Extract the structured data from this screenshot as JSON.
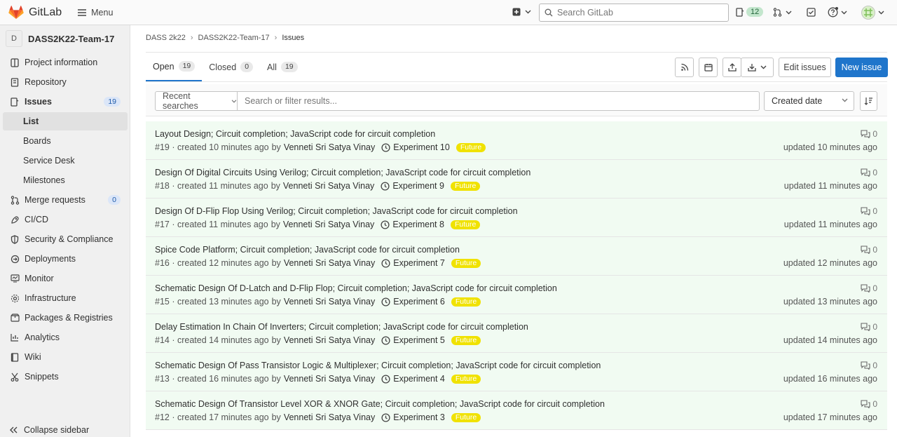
{
  "topbar": {
    "brand": "GitLab",
    "menu_label": "Menu",
    "search_placeholder": "Search GitLab",
    "issues_count": "12",
    "colors": {
      "brand_orange": "#fc6d26",
      "accent_blue": "#1f75cb",
      "label_yellow": "#f0e200"
    }
  },
  "sidebar": {
    "project_initial": "D",
    "project_name": "DASS2K22-Team-17",
    "items": [
      {
        "label": "Project information",
        "icon": "info-icon"
      },
      {
        "label": "Repository",
        "icon": "book-icon"
      },
      {
        "label": "Issues",
        "icon": "issues-icon",
        "badge": "19"
      },
      {
        "label": "List"
      },
      {
        "label": "Boards"
      },
      {
        "label": "Service Desk"
      },
      {
        "label": "Milestones"
      },
      {
        "label": "Merge requests",
        "icon": "git-merge-icon",
        "badge": "0"
      },
      {
        "label": "CI/CD",
        "icon": "rocket-icon"
      },
      {
        "label": "Security & Compliance",
        "icon": "shield-icon"
      },
      {
        "label": "Deployments",
        "icon": "deployments-icon"
      },
      {
        "label": "Monitor",
        "icon": "monitor-icon"
      },
      {
        "label": "Infrastructure",
        "icon": "cloud-gear-icon"
      },
      {
        "label": "Packages & Registries",
        "icon": "package-icon"
      },
      {
        "label": "Analytics",
        "icon": "chart-icon"
      },
      {
        "label": "Wiki",
        "icon": "wiki-icon"
      },
      {
        "label": "Snippets",
        "icon": "scissors-icon"
      }
    ],
    "collapse_label": "Collapse sidebar"
  },
  "breadcrumb": [
    "DASS 2k22",
    "DASS2K22-Team-17",
    "Issues"
  ],
  "tabs": [
    {
      "label": "Open",
      "count": "19"
    },
    {
      "label": "Closed",
      "count": "0"
    },
    {
      "label": "All",
      "count": "19"
    }
  ],
  "actions": {
    "edit_issues": "Edit issues",
    "new_issue": "New issue"
  },
  "filter": {
    "recent_searches": "Recent searches",
    "placeholder": "Search or filter results...",
    "sort": "Created date"
  },
  "issues": [
    {
      "title": "Layout Design; Circuit completion; JavaScript code for circuit completion",
      "ref": "#19 · created 10 minutes ago",
      "author": "Venneti Sri Satya Vinay",
      "milestone": "Experiment 10",
      "label": "Future",
      "comments": "0",
      "updated": "updated 10 minutes ago"
    },
    {
      "title": "Design Of Digital Circuits Using Verilog; Circuit completion; JavaScript code for circuit completion",
      "ref": "#18 · created 11 minutes ago",
      "author": "Venneti Sri Satya Vinay",
      "milestone": "Experiment 9",
      "label": "Future",
      "comments": "0",
      "updated": "updated 11 minutes ago"
    },
    {
      "title": "Design Of D-Flip Flop Using Verilog; Circuit completion; JavaScript code for circuit completion",
      "ref": "#17 · created 11 minutes ago",
      "author": "Venneti Sri Satya Vinay",
      "milestone": "Experiment 8",
      "label": "Future",
      "comments": "0",
      "updated": "updated 11 minutes ago"
    },
    {
      "title": "Spice Code Platform; Circuit completion; JavaScript code for circuit completion",
      "ref": "#16 · created 12 minutes ago",
      "author": "Venneti Sri Satya Vinay",
      "milestone": "Experiment 7",
      "label": "Future",
      "comments": "0",
      "updated": "updated 12 minutes ago"
    },
    {
      "title": "Schematic Design Of D-Latch and D-Flip Flop; Circuit completion; JavaScript code for circuit completion",
      "ref": "#15 · created 13 minutes ago",
      "author": "Venneti Sri Satya Vinay",
      "milestone": "Experiment 6",
      "label": "Future",
      "comments": "0",
      "updated": "updated 13 minutes ago"
    },
    {
      "title": "Delay Estimation In Chain Of Inverters; Circuit completion; JavaScript code for circuit completion",
      "ref": "#14 · created 14 minutes ago",
      "author": "Venneti Sri Satya Vinay",
      "milestone": "Experiment 5",
      "label": "Future",
      "comments": "0",
      "updated": "updated 14 minutes ago"
    },
    {
      "title": "Schematic Design Of Pass Transistor Logic & Multiplexer; Circuit completion; JavaScript code for circuit completion",
      "ref": "#13 · created 16 minutes ago",
      "author": "Venneti Sri Satya Vinay",
      "milestone": "Experiment 4",
      "label": "Future",
      "comments": "0",
      "updated": "updated 16 minutes ago"
    },
    {
      "title": "Schematic Design Of Transistor Level XOR & XNOR Gate; Circuit completion; JavaScript code for circuit completion",
      "ref": "#12 · created 17 minutes ago",
      "author": "Venneti Sri Satya Vinay",
      "milestone": "Experiment 3",
      "label": "Future",
      "comments": "0",
      "updated": "updated 17 minutes ago"
    }
  ]
}
